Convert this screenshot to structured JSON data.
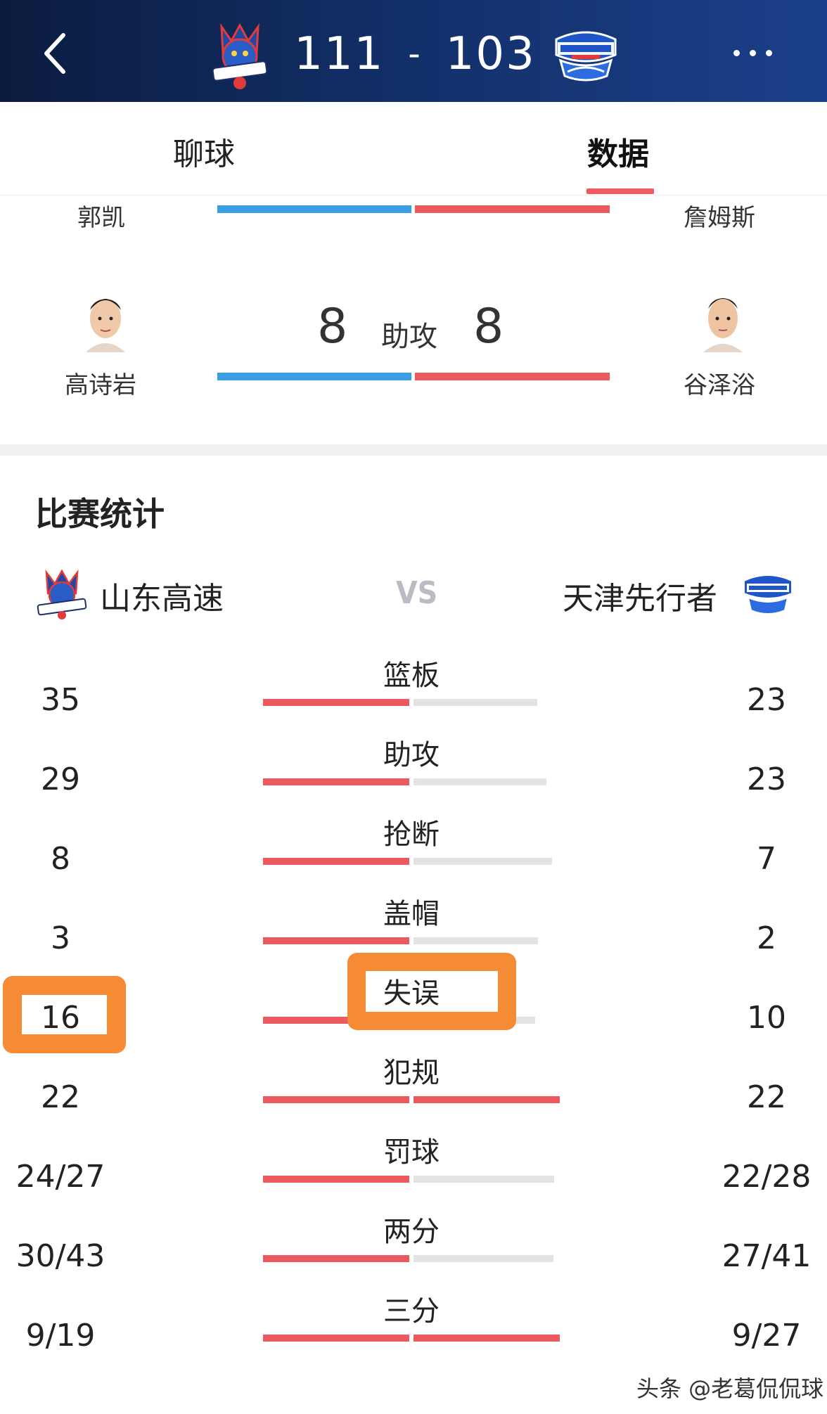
{
  "header": {
    "score_home": "111",
    "score_sep": "-",
    "score_away": "103",
    "home_logo_text": "SHANDONG",
    "away_logo_text": "PIONEERS",
    "colors": {
      "bg_start": "#0b1c3f",
      "bg_end": "#1b3f8a"
    }
  },
  "tabs": {
    "chat": "聊球",
    "data": "数据",
    "active": "数据"
  },
  "leaders": {
    "partial_row": {
      "home_player": "郭凯",
      "away_player": "詹姆斯"
    },
    "assists_row": {
      "home_player": "高诗岩",
      "away_player": "谷泽浴",
      "home_value": "8",
      "away_value": "8",
      "label": "助攻"
    }
  },
  "stats": {
    "title": "比赛统计",
    "home_team": "山东高速",
    "away_team": "天津先行者",
    "vs": "VS",
    "rows": [
      {
        "label": "篮板",
        "home": "35",
        "away": "23"
      },
      {
        "label": "助攻",
        "home": "29",
        "away": "23"
      },
      {
        "label": "抢断",
        "home": "8",
        "away": "7"
      },
      {
        "label": "盖帽",
        "home": "3",
        "away": "2"
      },
      {
        "label": "失误",
        "home": "16",
        "away": "10"
      },
      {
        "label": "犯规",
        "home": "22",
        "away": "22"
      },
      {
        "label": "罚球",
        "home": "24/27",
        "away": "22/28"
      },
      {
        "label": "两分",
        "home": "30/43",
        "away": "27/41"
      },
      {
        "label": "三分",
        "home": "9/19",
        "away": "9/27"
      }
    ],
    "colors": {
      "home_bar": "#ec5a5f",
      "away_bar_lose": "#e3e3e3",
      "highlight": "#f68b36"
    }
  },
  "watermark": "头条 @老葛侃侃球"
}
